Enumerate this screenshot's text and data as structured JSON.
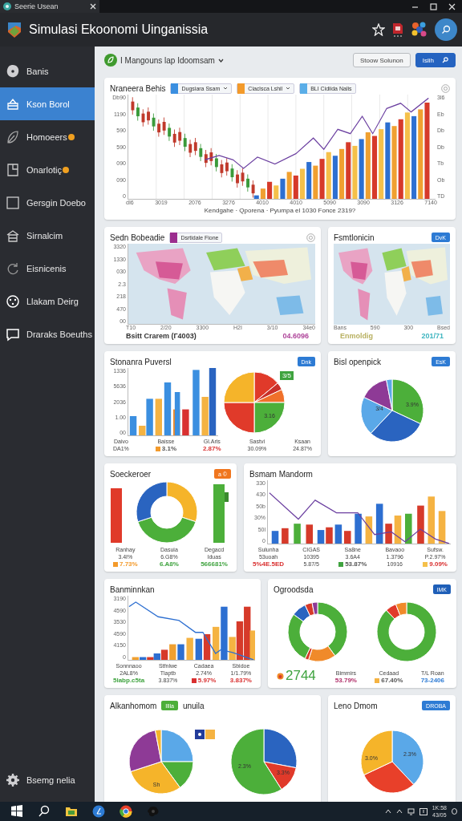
{
  "window": {
    "tab_title": "Seerie Usean"
  },
  "app": {
    "title": "Simulasi Ekoonomi Uinganissia"
  },
  "sidebar": {
    "items": [
      {
        "label": "Banis",
        "selected": false,
        "alert": false
      },
      {
        "label": "Kson Borol",
        "selected": true,
        "alert": false
      },
      {
        "label": "Homoeers",
        "selected": false,
        "alert": true
      },
      {
        "label": "Onarlotiç",
        "selected": false,
        "alert": true
      },
      {
        "label": "Gersgin Doebo",
        "selected": false,
        "alert": false
      },
      {
        "label": "Sirnalcim",
        "selected": false,
        "alert": false
      },
      {
        "label": "Eisnicenis",
        "selected": false,
        "alert": false
      },
      {
        "label": "Llakam Deirg",
        "selected": false,
        "alert": false
      },
      {
        "label": "Draraks Boeuths",
        "selected": false,
        "alert": false
      }
    ],
    "footer": {
      "label": "Bsemg nelia"
    }
  },
  "toolbar": {
    "workspace": "I Mangouns lap Idoomsam",
    "buttons": [
      {
        "label": "Stoow Solunon",
        "kind": "outline"
      },
      {
        "label": "Islih",
        "kind": "primary"
      }
    ]
  },
  "cards": [
    {
      "kind": "candle-bars",
      "title": "Nraneera Behis",
      "settings": true,
      "legend": [
        {
          "label": "Dugsiara Ssam",
          "color": "#3b8fe0",
          "dropdown": true
        },
        {
          "label": "Ciaclsca Lshil",
          "color": "#f39a2b",
          "dropdown": true
        },
        {
          "label": "BLI Cidiida Nalis",
          "color": "#5aaee8",
          "dropdown": false
        }
      ],
      "yticks": [
        "Db90",
        "1190",
        "590",
        "590",
        "090",
        "090",
        "0"
      ],
      "rticks": [
        "3l6",
        "Eb",
        "Db",
        "Db",
        "Tb",
        "Ob",
        "TD"
      ],
      "xticks": [
        "dI6",
        "3019",
        "2076",
        "3276",
        "4010",
        "4010",
        "5090",
        "3090",
        "3126",
        "7140"
      ],
      "xlabel": "Kendgahe · Qporena · Pyumpa el 1030 Fonce 2319?"
    },
    {
      "kind": "map",
      "title": "Sedn Bobeadie",
      "settings": true,
      "legend": [
        {
          "label": "Dsrtidale Fione",
          "color": "#9b2d8e",
          "dropdown": false
        }
      ],
      "yticks": [
        "3320",
        "1330",
        "030",
        "2.3",
        "218",
        "470",
        "00"
      ],
      "xticks": [
        "T10",
        "2/20",
        "3300",
        "H2I",
        "3/10",
        "34e0"
      ],
      "footer": [
        {
          "text": "Bsitt Crarem (Г4003)",
          "color": "#333333"
        },
        {
          "text": "04.6096",
          "color": "#b0489c"
        }
      ]
    },
    {
      "kind": "map",
      "title": "Fsmtlonicin",
      "badge": {
        "label": "DvK",
        "color": "#2d7bd4"
      },
      "xticks": [
        "Bans",
        "590",
        "300",
        "Bsed"
      ],
      "footer": [
        {
          "text": "Enmoldig",
          "color": "#b8b060"
        },
        {
          "text": "201/71",
          "color": "#3fb5c0"
        }
      ]
    },
    {
      "kind": "bar-pie",
      "title": "Stonanra Puversl",
      "badge": {
        "label": "Dnk",
        "color": "#2d7bd4"
      },
      "pie_badge": {
        "label": "3/5",
        "color": "#3fa33f"
      },
      "slice_labels": [
        "3.16"
      ],
      "yticks": [
        "1336",
        "5636",
        "2036",
        "1.00",
        "00"
      ],
      "stats": [
        {
          "lines": [
            "Daivo",
            "DA1%"
          ]
        },
        {
          "lines": [
            "Baisse"
          ],
          "accent": {
            "text": "3.1%",
            "color": "#555555"
          },
          "swatch": {
            "color": "#f39a2b"
          }
        },
        {
          "lines": [
            "Gl.Aris"
          ],
          "accent": {
            "text": "2.87%",
            "color": "#d93030"
          }
        },
        {
          "lines": [
            "Sastvi",
            "30.09%"
          ]
        },
        {
          "lines": [
            "Ksaan",
            "24.87%"
          ]
        }
      ]
    },
    {
      "kind": "pie",
      "title": "Bisl openpick",
      "badge": {
        "label": "EsK",
        "color": "#2d7bd4"
      },
      "slice_labels": [
        "3.9%",
        "3/4"
      ]
    },
    {
      "kind": "donut-bars",
      "title": "Soeckeroer",
      "badge": {
        "label": "a ©",
        "color": "#f0761e"
      },
      "stats": [
        {
          "lines": [
            "Ranhay",
            "3.4I%"
          ],
          "accent": {
            "text": "7.73%",
            "color": "#f39a2b"
          },
          "swatch": {
            "color": "#f39a2b"
          }
        },
        {
          "lines": [
            "Dasuia",
            "6.G8%"
          ],
          "accent": {
            "text": "6.A8%",
            "color": "#3fa33f"
          }
        },
        {
          "lines": [
            "Degacd",
            "Iduas"
          ],
          "accent": {
            "text": "566681%",
            "color": "#3fa33f"
          }
        }
      ]
    },
    {
      "kind": "bars-line",
      "title": "Bsmam Mandorm",
      "yticks": [
        "330",
        "430",
        "50b",
        "30%",
        "50l",
        "0"
      ],
      "stats": [
        {
          "lines": [
            "Sulunha",
            "53uoah"
          ],
          "accent": {
            "text": "5%4E.5ED",
            "color": "#d93030"
          }
        },
        {
          "lines": [
            "CIGAS",
            "10395",
            "5.87/5"
          ]
        },
        {
          "lines": [
            "Sa8ne",
            "3.6A4"
          ],
          "accent": {
            "text": "53.87%",
            "color": "#555555"
          },
          "swatch": {
            "color": "#3fa33f"
          }
        },
        {
          "lines": [
            "Bavaoo",
            "1.3796",
            "10916"
          ]
        },
        {
          "lines": [
            "Sufsw.",
            "P.2.97%"
          ],
          "accent": {
            "text": "9.09%",
            "color": "#d93030"
          },
          "swatch": {
            "color": "#f5c04a"
          }
        }
      ]
    },
    {
      "kind": "rising-bars",
      "title": "Banminnkan",
      "yticks": [
        "3190",
        "4590",
        "3530",
        "4590",
        "4150",
        "0"
      ],
      "stats": [
        {
          "lines": [
            "Sonnnaoo",
            "2AL8%"
          ],
          "accent": {
            "text": "5labp.c5ta",
            "color": "#3fa33f"
          }
        },
        {
          "lines": [
            "Stfnlwe",
            "Tlaptb",
            "3.837%"
          ]
        },
        {
          "lines": [
            "Cadaea",
            "2.74%"
          ],
          "accent": {
            "text": "5.97%",
            "color": "#d93030"
          },
          "swatch": {
            "color": "#d93030"
          }
        },
        {
          "lines": [
            "Sbidoe",
            "1/1.79%"
          ],
          "accent": {
            "text": "3.837%",
            "color": "#d93030"
          }
        }
      ]
    },
    {
      "kind": "donuts",
      "title": "Ogroodsda",
      "badge": {
        "label": "IMK",
        "color": "#1f5fb8"
      },
      "headline": {
        "text": "2744",
        "color": "#3fa33f"
      },
      "stats": [
        {
          "lines": [
            "Bimmirs"
          ],
          "accent": {
            "text": "53.79%",
            "color": "#b0306a"
          }
        },
        {
          "lines": [
            "Cedaad"
          ],
          "accent": {
            "text": "67.40%",
            "color": "#555555"
          },
          "swatch": {
            "color": "#f5b342"
          }
        },
        {
          "lines": [
            "T/L Roan"
          ],
          "accent": {
            "text": "73-2406",
            "color": "#2d7bd4"
          }
        }
      ]
    },
    {
      "kind": "pies",
      "title": "Alkanhomom",
      "badge": {
        "label": "Illla",
        "color": "#4caf3a"
      },
      "subtitle": "unuila",
      "slice_labels": [
        "Sh",
        "2.3%",
        "3.3%"
      ]
    },
    {
      "kind": "pie",
      "title": "Leno Dmom",
      "badge": {
        "label": "DROBA",
        "color": "#2d7bd4"
      },
      "slice_labels": [
        "2.3%",
        "3.0%"
      ]
    }
  ],
  "taskbar": {
    "time": "1K:58",
    "date": "43/05"
  }
}
